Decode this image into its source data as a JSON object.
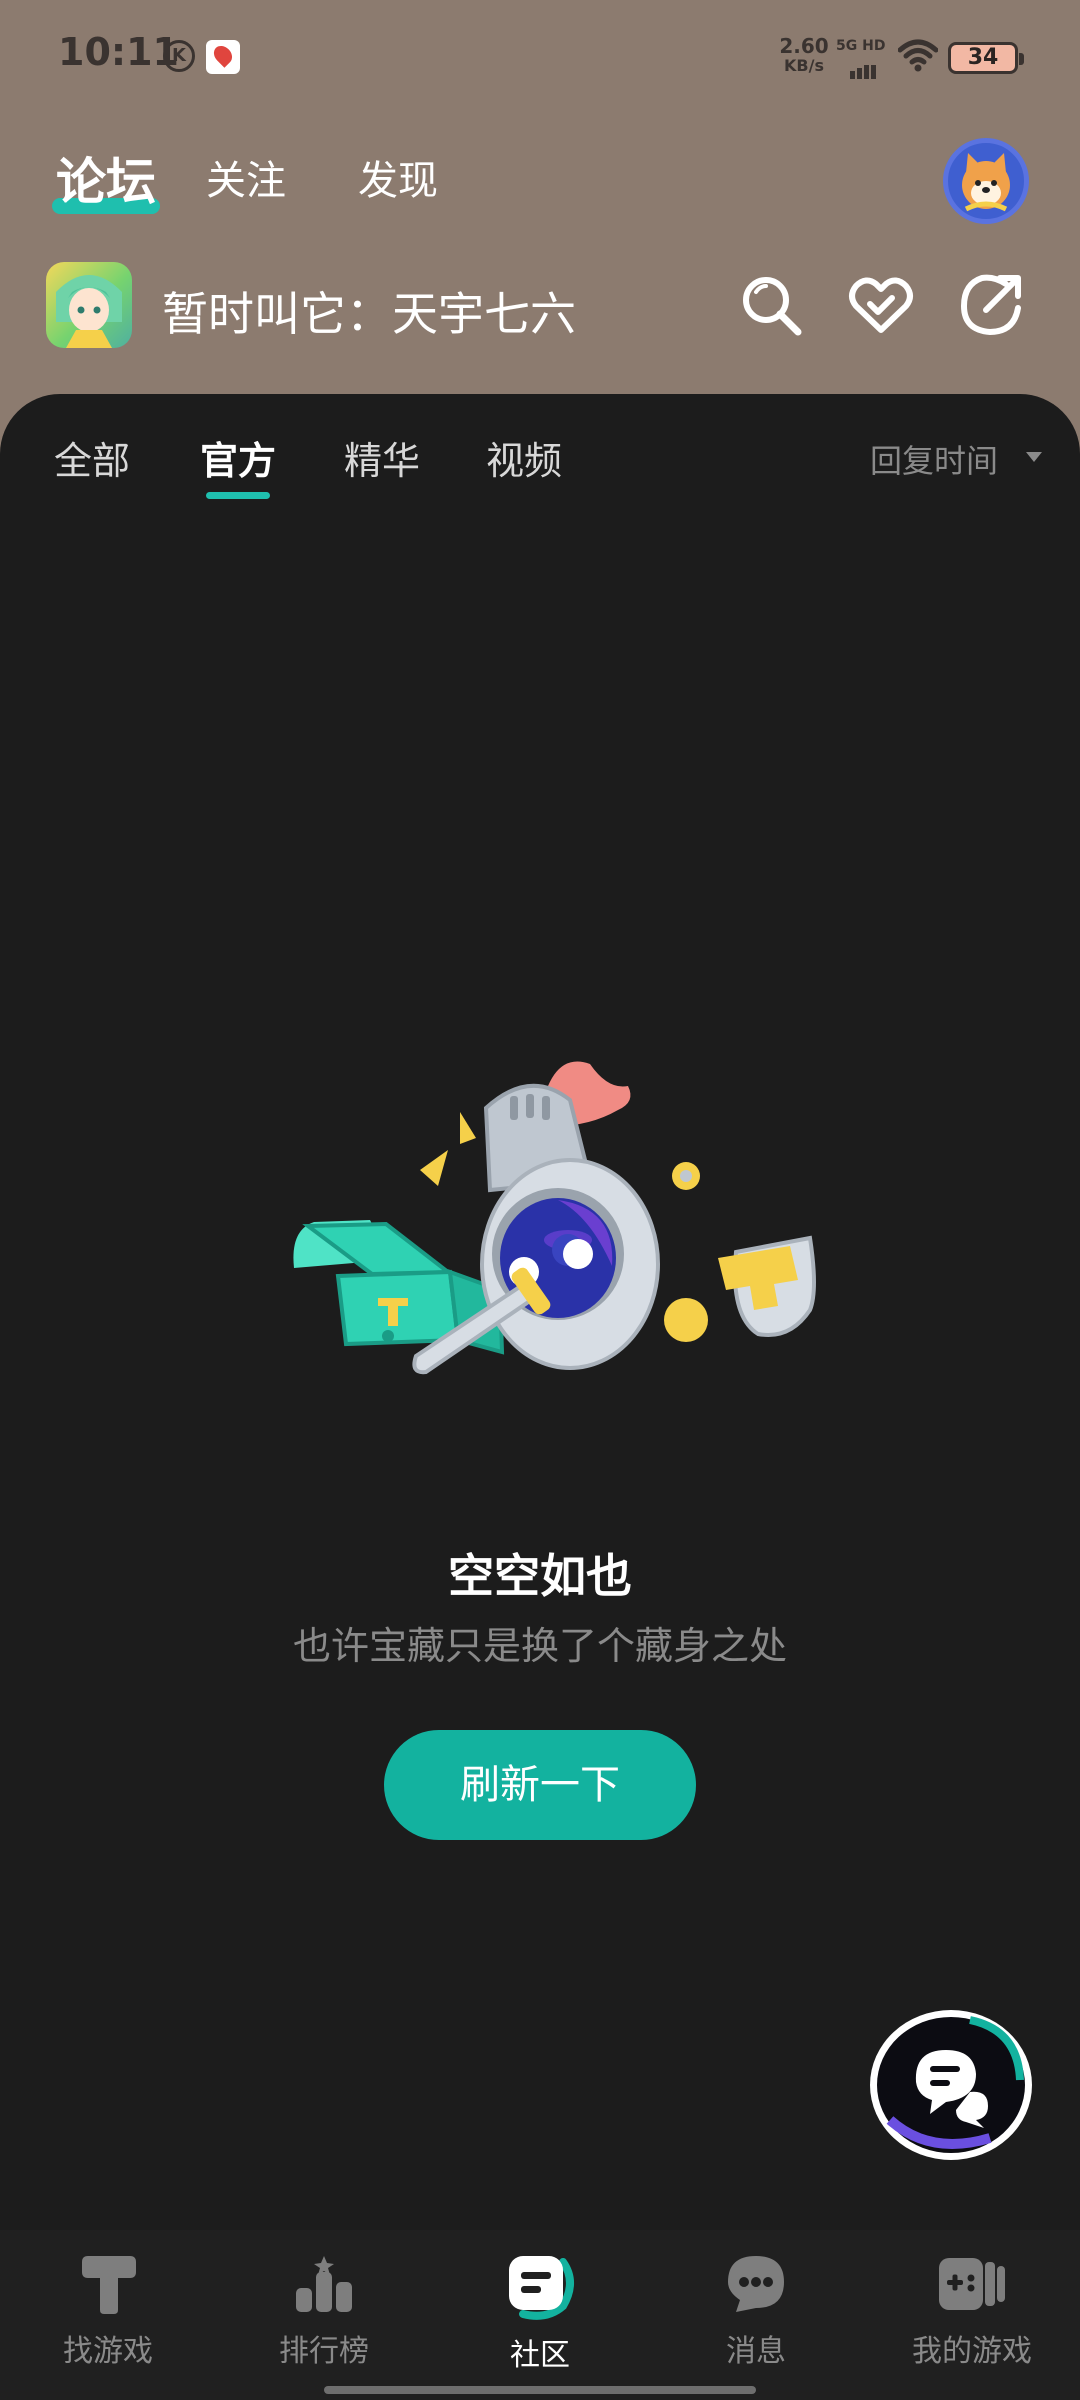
{
  "status_bar": {
    "time": "10:11",
    "net_speed": "2.60",
    "net_speed_unit": "KB/s",
    "network": "5G HD",
    "battery": "34"
  },
  "top_tabs": [
    {
      "label": "论坛",
      "active": true
    },
    {
      "label": "关注",
      "active": false
    },
    {
      "label": "发现",
      "active": false
    }
  ],
  "forum": {
    "name": "暂时叫它：天宇七六"
  },
  "sub_tabs": [
    {
      "label": "全部",
      "active": false
    },
    {
      "label": "官方",
      "active": true
    },
    {
      "label": "精华",
      "active": false
    },
    {
      "label": "视频",
      "active": false
    }
  ],
  "sort": {
    "label": "回复时间"
  },
  "empty_state": {
    "title": "空空如也",
    "subtitle": "也许宝藏只是换了个藏身之处",
    "button": "刷新一下"
  },
  "bottom_nav": [
    {
      "label": "找游戏",
      "icon": "find-game-icon",
      "active": false
    },
    {
      "label": "排行榜",
      "icon": "ranking-icon",
      "active": false
    },
    {
      "label": "社区",
      "icon": "community-icon",
      "active": true
    },
    {
      "label": "消息",
      "icon": "message-icon",
      "active": false
    },
    {
      "label": "我的游戏",
      "icon": "my-games-icon",
      "active": false
    }
  ],
  "colors": {
    "accent": "#13b29f",
    "header_bg": "#8c7b6f",
    "panel_bg": "#1c1c1c"
  }
}
